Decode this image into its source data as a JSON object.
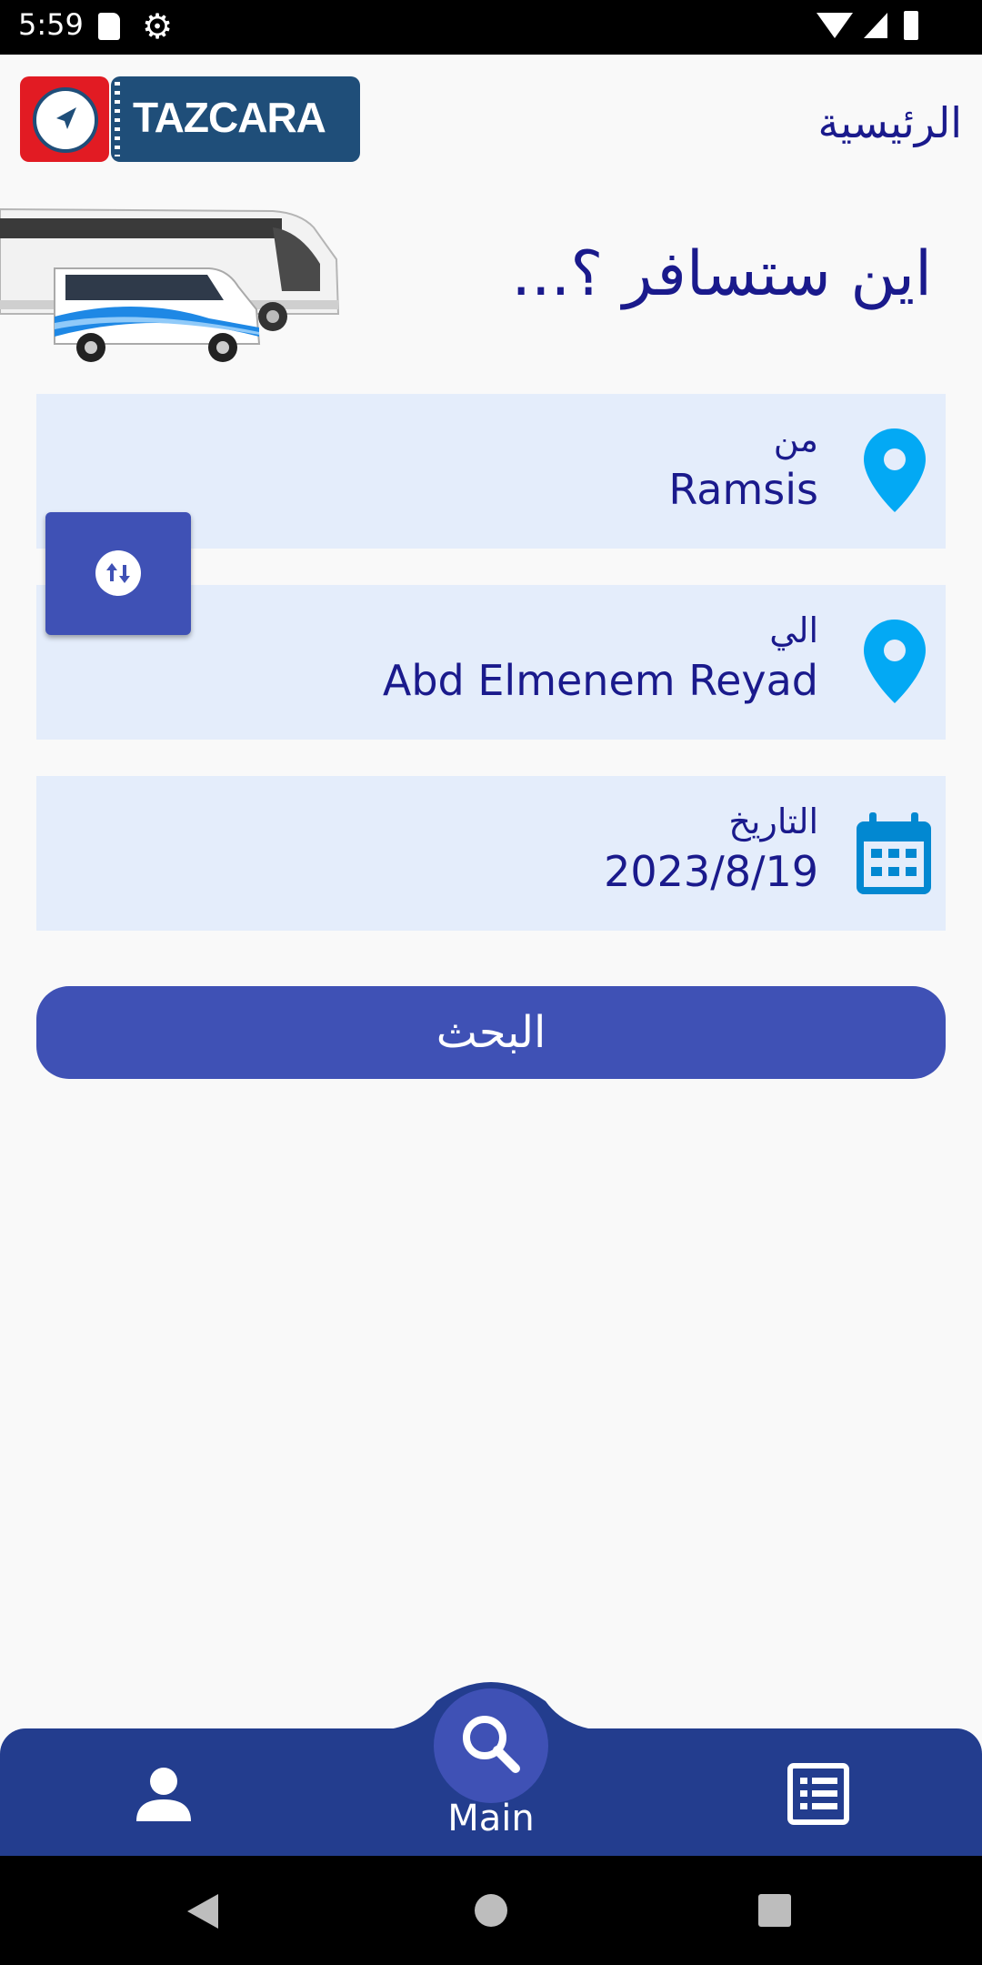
{
  "status_bar": {
    "time": "5:59"
  },
  "header": {
    "logo_text": "TAZCARA",
    "page_title": "الرئيسية"
  },
  "hero": {
    "question": "اين ستسافر ؟..."
  },
  "form": {
    "from": {
      "label": "من",
      "value": "Ramsis",
      "icon": "location-pin-icon"
    },
    "to": {
      "label": "الي",
      "value": "Abd Elmenem Reyad",
      "icon": "location-pin-icon"
    },
    "date": {
      "label": "التاريخ",
      "value": "2023/8/19",
      "icon": "calendar-icon"
    },
    "swap_icon": "swap-vertical-icon",
    "search_label": "البحث"
  },
  "bottom_nav": {
    "main_label": "Main",
    "items": [
      "profile-icon",
      "search-icon",
      "list-icon"
    ]
  },
  "colors": {
    "primary": "#3f51b5",
    "nav_bar": "#233d8e",
    "field_bg": "#e4edfb",
    "text": "#1a1a8c",
    "pin": "#03a9f4",
    "calendar": "#0288d1",
    "logo_red": "#e21b23",
    "logo_blue": "#1f4e79"
  }
}
